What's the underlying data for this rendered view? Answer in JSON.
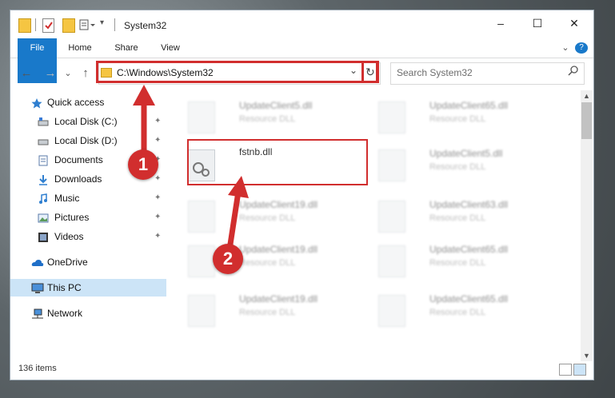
{
  "window": {
    "title": "System32",
    "minimize_glyph": "–",
    "maximize_glyph": "☐",
    "close_glyph": "✕"
  },
  "ribbon": {
    "tabs": [
      "File",
      "Home",
      "Share",
      "View"
    ],
    "expand_glyph": "⌄",
    "help_glyph": "?"
  },
  "address": {
    "path": "C:\\Windows\\System32",
    "dropdown_glyph": "⌄",
    "refresh_glyph": "↻"
  },
  "search": {
    "placeholder": "Search System32",
    "icon": "search-icon"
  },
  "nav_buttons": {
    "back": "←",
    "forward": "→",
    "recent": "⌄",
    "up": "↑"
  },
  "sidebar": {
    "items": [
      {
        "label": "Quick access",
        "icon": "star-icon"
      },
      {
        "label": "Local Disk (C:)",
        "icon": "drive-icon",
        "pinned": true
      },
      {
        "label": "Local Disk (D:)",
        "icon": "drive-icon",
        "pinned": true
      },
      {
        "label": "Documents",
        "icon": "documents-icon",
        "pinned": true
      },
      {
        "label": "Downloads",
        "icon": "download-icon",
        "pinned": true
      },
      {
        "label": "Music",
        "icon": "music-icon",
        "pinned": true
      },
      {
        "label": "Pictures",
        "icon": "pictures-icon",
        "pinned": true
      },
      {
        "label": "Videos",
        "icon": "videos-icon",
        "pinned": true
      },
      {
        "label": "OneDrive",
        "icon": "cloud-icon"
      },
      {
        "label": "This PC",
        "icon": "computer-icon",
        "selected": true
      },
      {
        "label": "Network",
        "icon": "network-icon"
      }
    ],
    "pin_glyph": "📌"
  },
  "files": [
    {
      "name": "UpdateClient5.dll",
      "desc": "Resource DLL",
      "blurred": true
    },
    {
      "name": "UpdateClient65.dll",
      "desc": "Resource DLL",
      "blurred": true
    },
    {
      "name": "fstnb.dll",
      "desc": "",
      "blurred": false,
      "highlighted": true
    },
    {
      "name": "UpdateClient5.dll",
      "desc": "Resource DLL",
      "blurred": true
    },
    {
      "name": "UpdateClient19.dll",
      "desc": "Resource DLL",
      "blurred": true
    },
    {
      "name": "UpdateClient63.dll",
      "desc": "Resource DLL",
      "blurred": true
    },
    {
      "name": "UpdateClient19.dll",
      "desc": "Resource DLL",
      "blurred": true
    },
    {
      "name": "UpdateClient65.dll",
      "desc": "Resource DLL",
      "blurred": true
    },
    {
      "name": "UpdateClient19.dll",
      "desc": "Resource DLL",
      "blurred": true
    },
    {
      "name": "UpdateClient65.dll",
      "desc": "Resource DLL",
      "blurred": true
    }
  ],
  "status": {
    "item_count": "136 items"
  },
  "annotations": {
    "step1": "1",
    "step2": "2",
    "color": "#d12e2e"
  }
}
